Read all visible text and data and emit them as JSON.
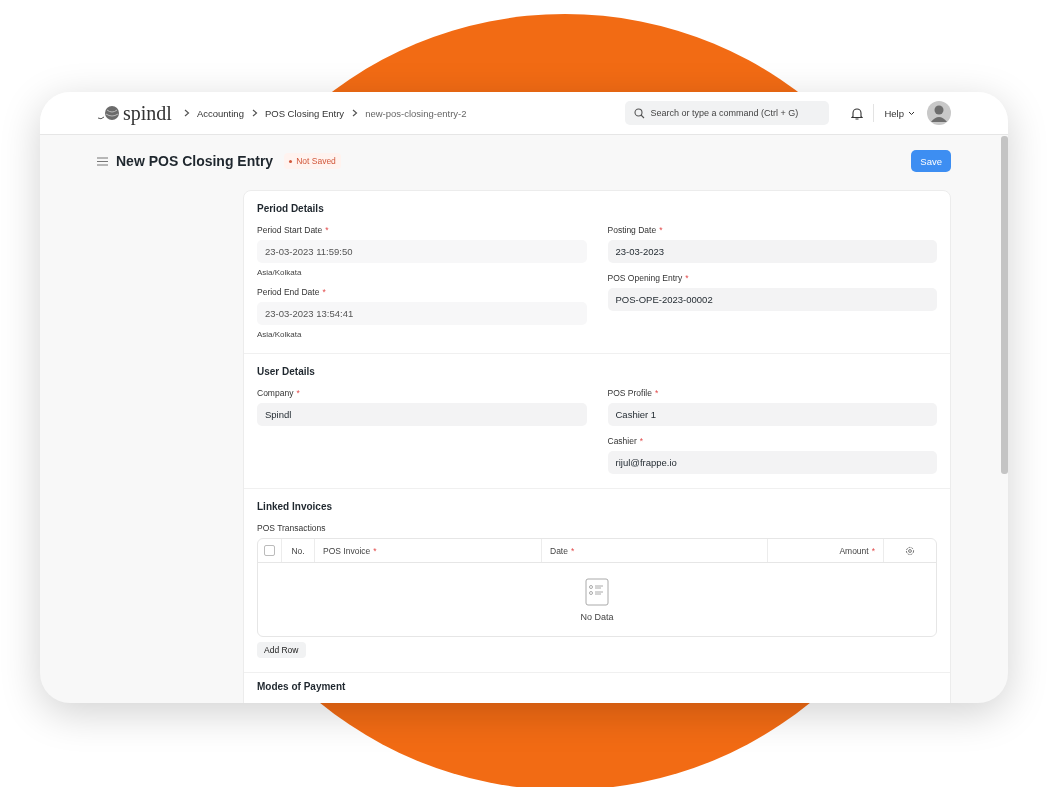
{
  "navbar": {
    "logo": "spindl",
    "breadcrumbs": [
      "Accounting",
      "POS Closing Entry",
      "new-pos-closing-entry-2"
    ],
    "search": {
      "placeholder": "Search or type a command (Ctrl + G)"
    },
    "help": "Help"
  },
  "page": {
    "title": "New POS Closing Entry",
    "status": "Not Saved",
    "save": "Save"
  },
  "sections": [
    {
      "title": "Period Details",
      "columns": [
        [
          {
            "label": "Period Start Date",
            "mark": "*",
            "value": "23-03-2023 11:59:50",
            "read_only": true,
            "note": "Asia/Kolkata"
          },
          {
            "label": "Period End Date",
            "mark": "*",
            "value": "23-03-2023 13:54:41",
            "read_only": true,
            "note": "Asia/Kolkata"
          }
        ],
        [
          {
            "label": "Posting Date",
            "mark": "*",
            "value": "23-03-2023",
            "read_only": false
          },
          {
            "label": "POS Opening Entry",
            "mark": "*",
            "value": "POS-OPE-2023-00002",
            "read_only": false
          }
        ]
      ]
    },
    {
      "title": "User Details",
      "columns": [
        [
          {
            "label": "Company",
            "mark": "*",
            "value": "Spindl",
            "read_only": false
          }
        ],
        [
          {
            "label": "POS Profile",
            "mark": "*",
            "value": "Cashier 1",
            "read_only": false
          },
          {
            "label": "Cashier",
            "mark": "*",
            "value": "rijul@frappe.io",
            "read_only": false
          }
        ]
      ]
    }
  ],
  "linked": {
    "title": "Linked Invoices",
    "table_label": "POS Transactions",
    "select_all": {
      "checked": false
    },
    "columns": [
      {
        "label": "No."
      },
      {
        "label": "POS Invoice",
        "mark": "*"
      },
      {
        "label": "Date",
        "mark": "*"
      },
      {
        "label": "Amount",
        "mark": "*"
      }
    ],
    "empty": "No Data",
    "add_row": "Add Row"
  },
  "next_section": {
    "title": "Modes of Payment"
  }
}
